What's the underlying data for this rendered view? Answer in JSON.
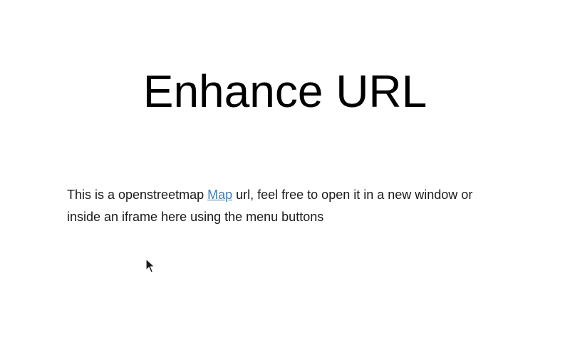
{
  "page": {
    "title": "Enhance URL"
  },
  "intro": {
    "text_before": "This is a openstreetmap ",
    "link_text": "Map",
    "text_after": " url, feel free to open it in a new window or inside an iframe here using the menu buttons"
  },
  "colors": {
    "link": "#3d7fbf",
    "text": "#1a1a1a",
    "background": "#ffffff"
  },
  "icons": {
    "cursor": "mouse-pointer-icon"
  }
}
